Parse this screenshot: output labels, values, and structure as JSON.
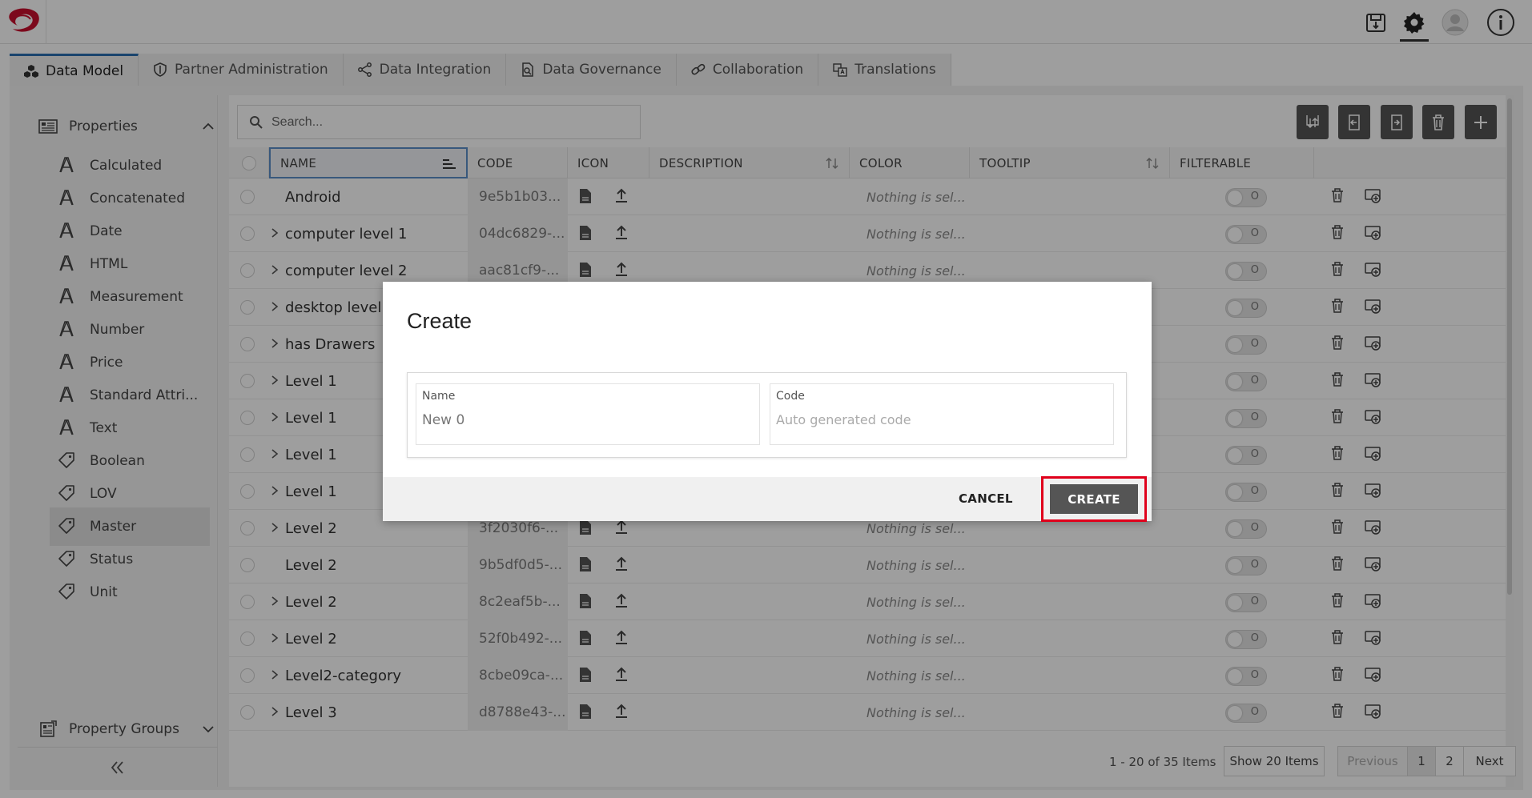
{
  "colors": {
    "accent": "#2b6fb0",
    "brand_red": "#c8102e",
    "highlight": "#e0001b",
    "button_dark": "#545454"
  },
  "topbar": {
    "icons": [
      "export-icon",
      "settings-icon",
      "user-avatar-icon",
      "info-icon"
    ]
  },
  "tabs": [
    {
      "label": "Data Model",
      "icon": "cubes-icon"
    },
    {
      "label": "Partner Administration",
      "icon": "shield-icon"
    },
    {
      "label": "Data Integration",
      "icon": "share-nodes-icon"
    },
    {
      "label": "Data Governance",
      "icon": "document-search-icon"
    },
    {
      "label": "Collaboration",
      "icon": "link-icon"
    },
    {
      "label": "Translations",
      "icon": "translate-icon"
    }
  ],
  "sidebar": {
    "properties_label": "Properties",
    "items": [
      {
        "label": "Calculated",
        "icon": "attribute-icon"
      },
      {
        "label": "Concatenated",
        "icon": "attribute-icon"
      },
      {
        "label": "Date",
        "icon": "attribute-icon"
      },
      {
        "label": "HTML",
        "icon": "attribute-icon"
      },
      {
        "label": "Measurement",
        "icon": "attribute-icon"
      },
      {
        "label": "Number",
        "icon": "attribute-icon"
      },
      {
        "label": "Price",
        "icon": "attribute-icon"
      },
      {
        "label": "Standard Attri...",
        "icon": "attribute-icon"
      },
      {
        "label": "Text",
        "icon": "attribute-icon"
      },
      {
        "label": "Boolean",
        "icon": "tag-icon"
      },
      {
        "label": "LOV",
        "icon": "tag-icon"
      },
      {
        "label": "Master",
        "icon": "tag-icon"
      },
      {
        "label": "Status",
        "icon": "tag-icon"
      },
      {
        "label": "Unit",
        "icon": "tag-icon"
      }
    ],
    "property_groups_label": "Property Groups"
  },
  "search": {
    "placeholder": "Search..."
  },
  "table": {
    "columns": [
      "NAME",
      "CODE",
      "ICON",
      "DESCRIPTION",
      "COLOR",
      "TOOLTIP",
      "FILTERABLE"
    ],
    "rows": [
      {
        "name": "Android",
        "expandable": false,
        "code": "9e5b1b03...",
        "color": "Nothing is sel..."
      },
      {
        "name": "computer level 1",
        "expandable": true,
        "code": "04dc6829-...",
        "color": "Nothing is sel..."
      },
      {
        "name": "computer level 2",
        "expandable": true,
        "code": "aac81cf9-...",
        "color": "Nothing is sel..."
      },
      {
        "name": "desktop level 1",
        "expandable": true,
        "code": "",
        "color": ""
      },
      {
        "name": "has Drawers",
        "expandable": true,
        "code": "",
        "color": ""
      },
      {
        "name": "Level 1",
        "expandable": true,
        "code": "",
        "color": ""
      },
      {
        "name": "Level 1",
        "expandable": true,
        "code": "",
        "color": ""
      },
      {
        "name": "Level 1",
        "expandable": true,
        "code": "",
        "color": ""
      },
      {
        "name": "Level 1",
        "expandable": true,
        "code": "",
        "color": ""
      },
      {
        "name": "Level 2",
        "expandable": true,
        "code": "3f2030f6-...",
        "color": "Nothing is sel..."
      },
      {
        "name": "Level 2",
        "expandable": false,
        "code": "9b5df0d5-...",
        "color": "Nothing is sel..."
      },
      {
        "name": "Level 2",
        "expandable": true,
        "code": "8c2eaf5b-...",
        "color": "Nothing is sel..."
      },
      {
        "name": "Level 2",
        "expandable": true,
        "code": "52f0b492-...",
        "color": "Nothing is sel..."
      },
      {
        "name": "Level2-category",
        "expandable": true,
        "code": "8cbe09ca-...",
        "color": "Nothing is sel..."
      },
      {
        "name": "Level 3",
        "expandable": true,
        "code": "d8788e43-...",
        "color": "Nothing is sel..."
      }
    ]
  },
  "pager": {
    "info": "1 - 20 of 35 Items",
    "show_label": "Show 20 Items",
    "previous": "Previous",
    "page1": "1",
    "page2": "2",
    "next": "Next"
  },
  "modal": {
    "title": "Create",
    "name_label": "Name",
    "name_value": "New 0",
    "code_label": "Code",
    "code_placeholder": "Auto generated code",
    "cancel": "CANCEL",
    "create": "CREATE"
  }
}
